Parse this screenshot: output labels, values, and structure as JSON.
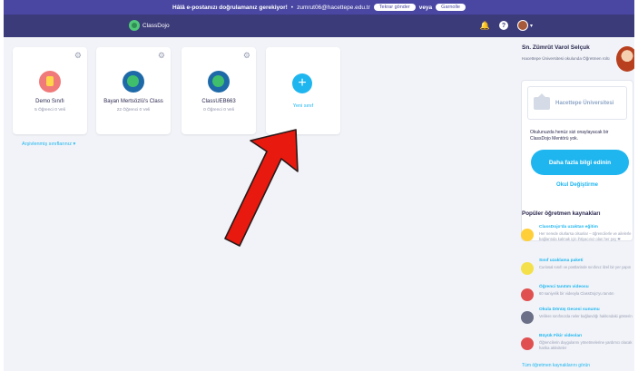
{
  "banner": {
    "message": "Hâlâ e-postanızı doğrulamanız gerekiyor!",
    "separator": "•",
    "email": "zumrut06@hacettepe.edu.tr",
    "resend_label": "Tekrar gönder",
    "or_label": "veya",
    "change_label": "Garnolle"
  },
  "nav": {
    "logo_text": "ClassDojo",
    "bell_glyph": "🔔",
    "help_glyph": "?",
    "caret_glyph": "▾"
  },
  "classes": [
    {
      "name": "Demo Sınıfı",
      "stats": "5 Öğrenci 0 Veli"
    },
    {
      "name": "Bayan Mertsözlü's Class",
      "stats": "22 Öğrenci 0 Veli"
    },
    {
      "name": "ClassUEB663",
      "stats": "0 Öğrenci 0 Veli"
    }
  ],
  "new_class": {
    "plus": "+",
    "label": "Yeni sınıf"
  },
  "gear_glyph": "⚙",
  "archived_link": "Arşivlenmiş sınıflarınız ▾",
  "teacher": {
    "name": "Sn. Zümrüt Varol Selçuk",
    "subtitle": "Hacettepe Üniversitesi okulunda Öğretmen rolü"
  },
  "school": {
    "name": "Hacettepe Üniversitesi",
    "note": "Okulunuzda henüz sizi onaylayacak bir ClassDojo Mentörü yok.",
    "more_button": "Daha fazla bilgi edinin",
    "change_button": "Okul Değiştirme"
  },
  "resources": {
    "heading": "Popüler öğretmen kaynakları",
    "items": [
      {
        "title": "ClassDojo'da uzaktan eğitim",
        "desc": "Her nerede olurlarsa olsunlar – öğrencilerle ve ailelerle bağlantıda kalmak için ihtiyacınız olan her şey ❤"
      },
      {
        "title": "Sınıf uzaklama paketi",
        "desc": "Curiosal sınıfı ve postlarinde sınıfınız ilzel bir yer yapın"
      },
      {
        "title": "Öğrenci tanıtım videosu",
        "desc": "60 saniyelik bir videoyla ClassDojo'yu tanıtın"
      },
      {
        "title": "Okula Dönüş Gecesi sunumu",
        "desc": "Velilere sınıfınızda neler bağlandığı hakkındaki gösterin"
      },
      {
        "title": "Büyük Fikir videoları",
        "desc": "Öğrencilerin duygularını yönetmelerine yardımcı olacak harika aktiviteler"
      }
    ],
    "all_link": "Tüm öğretmen kaynaklarını görün"
  },
  "colors": {
    "accent": "#1fb6f0",
    "nav": "#3c3b7a",
    "banner": "#4a47a3",
    "arrow": "#e8190f"
  }
}
